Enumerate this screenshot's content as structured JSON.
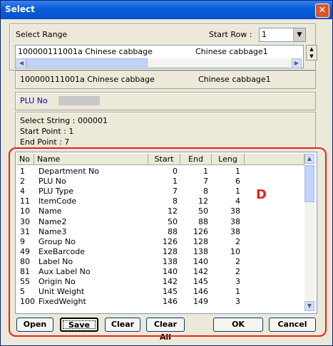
{
  "window": {
    "title": "Select"
  },
  "select_range": {
    "label": "Select Range",
    "start_row_label": "Start Row :",
    "start_row_value": "1",
    "range_code": "100000111001a Chinese cabbage",
    "range_name": "Chinese cabbage1"
  },
  "current_item": {
    "code": "100000111001a Chinese cabbage",
    "name": "Chinese cabbage1"
  },
  "field_selected": "PLU No",
  "info": {
    "select_string": "Select String : 000001",
    "start_point": "Start Point : 1",
    "end_point": "End Point : 7"
  },
  "table": {
    "headers": [
      "No",
      "Name",
      "Start",
      "End",
      "Leng"
    ],
    "rows": [
      [
        "1",
        "Department No",
        "0",
        "1",
        "1"
      ],
      [
        "2",
        "PLU No",
        "1",
        "7",
        "6"
      ],
      [
        "4",
        "PLU Type",
        "7",
        "8",
        "1"
      ],
      [
        "11",
        "ItemCode",
        "8",
        "12",
        "4"
      ],
      [
        "10",
        "Name",
        "12",
        "50",
        "38"
      ],
      [
        "30",
        "Name2",
        "50",
        "88",
        "38"
      ],
      [
        "31",
        "Name3",
        "88",
        "126",
        "38"
      ],
      [
        "9",
        "Group No",
        "126",
        "128",
        "2"
      ],
      [
        "49",
        "ExeBarcode",
        "128",
        "138",
        "10"
      ],
      [
        "80",
        "Label No",
        "138",
        "140",
        "2"
      ],
      [
        "81",
        "Aux Label No",
        "140",
        "142",
        "2"
      ],
      [
        "55",
        "Origin No",
        "142",
        "145",
        "3"
      ],
      [
        "5",
        "Unit Weight",
        "145",
        "146",
        "1"
      ],
      [
        "100",
        "FixedWeight",
        "146",
        "149",
        "3"
      ]
    ]
  },
  "annotation": "D",
  "buttons": {
    "open": "Open",
    "save": "Save",
    "clear": "Clear",
    "clear_all": "Clear All",
    "ok": "OK",
    "cancel": "Cancel"
  },
  "colors": {
    "title_bar": "#0a5fd9",
    "highlight_frame": "#e8201c",
    "field_text": "#0000c0"
  }
}
